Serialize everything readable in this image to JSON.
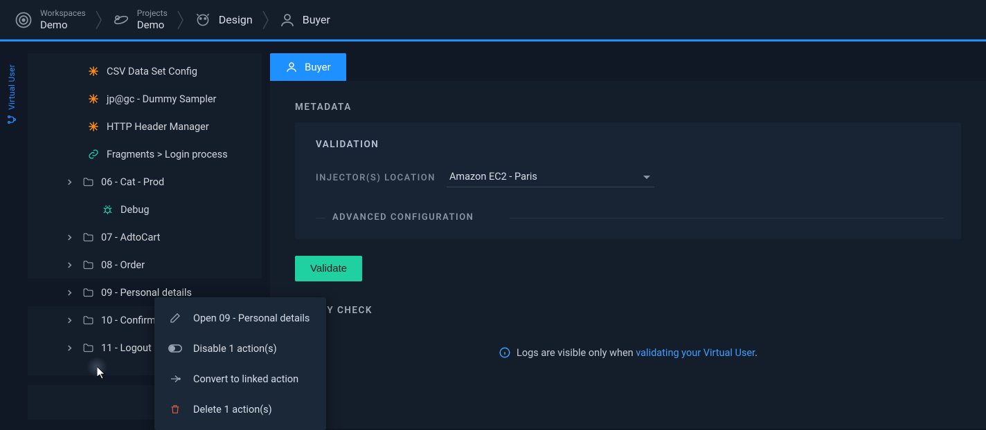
{
  "breadcrumb": [
    {
      "label": "Workspaces",
      "value": "Demo"
    },
    {
      "label": "Projects",
      "value": "Demo"
    },
    {
      "single": "Design"
    },
    {
      "single": "Buyer"
    }
  ],
  "leftrail": {
    "label": "Virtual User"
  },
  "tree": [
    {
      "label": "CSV Data Set Config",
      "icon": "asterisk"
    },
    {
      "label": "jp@gc - Dummy Sampler",
      "icon": "asterisk"
    },
    {
      "label": "HTTP Header Manager",
      "icon": "asterisk"
    },
    {
      "label": "Fragments > Login process",
      "icon": "link"
    },
    {
      "label": "06 - Cat - Prod",
      "icon": "folder",
      "chev": true
    },
    {
      "label": "Debug",
      "icon": "bug"
    },
    {
      "label": "07 - AdtoCart",
      "icon": "folder",
      "chev": true
    },
    {
      "label": "08 - Order",
      "icon": "folder",
      "chev": true
    },
    {
      "label": "09 - Personal details",
      "icon": "folder",
      "chev": true,
      "selected": true
    },
    {
      "label": "10 - Confirm",
      "icon": "folder",
      "chev": true
    },
    {
      "label": "11 - Logout",
      "icon": "folder",
      "chev": true
    }
  ],
  "tab": {
    "label": "Buyer"
  },
  "sections": {
    "metadata": "METADATA",
    "validation": "VALIDATION",
    "injector_label": "INJECTOR(S) LOCATION",
    "injector_value": "Amazon EC2 - Paris",
    "advanced": "ADVANCED CONFIGURATION",
    "validate_btn": "Validate",
    "sanity": "SANITY CHECK",
    "info_pre": "Logs are visible only when ",
    "info_link": "validating your Virtual User",
    "info_post": "."
  },
  "context_menu": [
    {
      "label": "Open 09 - Personal details",
      "icon": "edit"
    },
    {
      "label": "Disable 1 action(s)",
      "icon": "toggle"
    },
    {
      "label": "Convert to linked action",
      "icon": "arrow-link"
    },
    {
      "label": "Delete 1 action(s)",
      "icon": "trash",
      "delete": true
    }
  ]
}
